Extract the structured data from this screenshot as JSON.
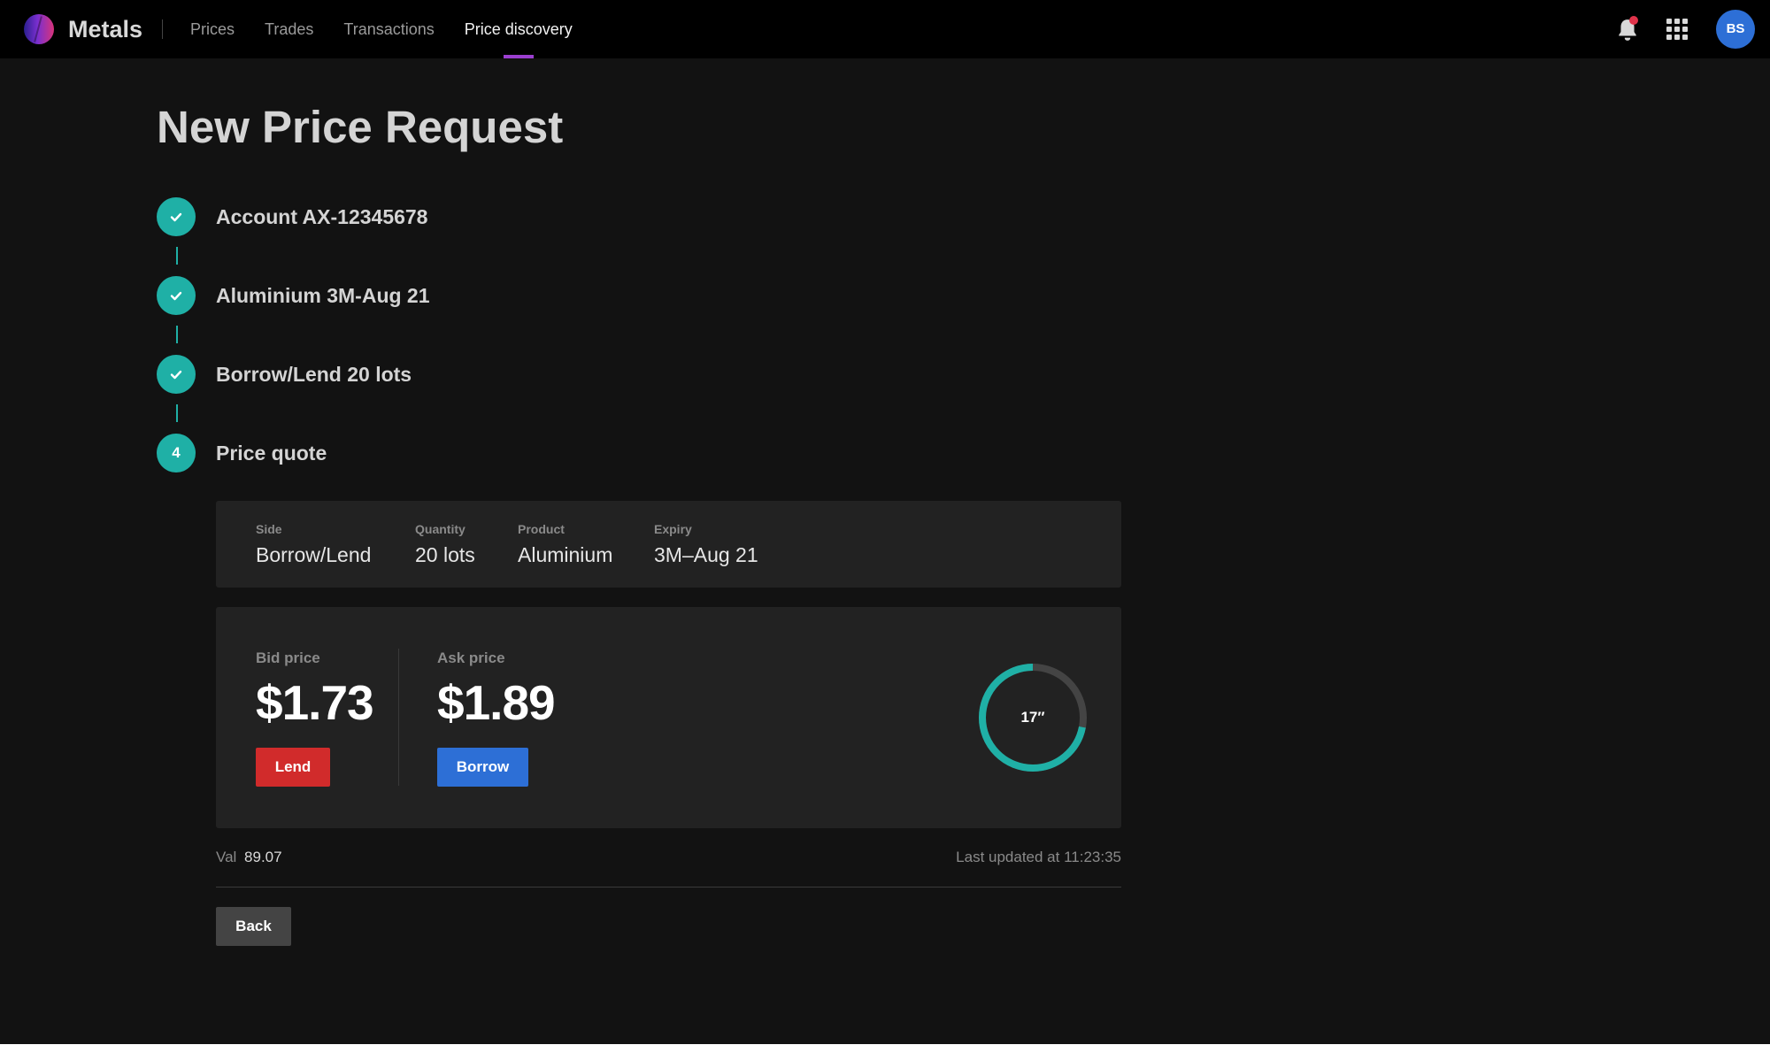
{
  "app": {
    "name": "Metals",
    "avatar_initials": "BS"
  },
  "nav": {
    "items": [
      {
        "label": "Prices",
        "active": false
      },
      {
        "label": "Trades",
        "active": false
      },
      {
        "label": "Transactions",
        "active": false
      },
      {
        "label": "Price discovery",
        "active": true
      }
    ]
  },
  "page": {
    "title": "New Price Request"
  },
  "steps": [
    {
      "label": "Account AX-12345678",
      "state": "done",
      "marker": ""
    },
    {
      "label": "Aluminium 3M-Aug 21",
      "state": "done",
      "marker": ""
    },
    {
      "label": "Borrow/Lend 20 lots",
      "state": "done",
      "marker": ""
    },
    {
      "label": "Price quote",
      "state": "current",
      "marker": "4"
    }
  ],
  "summary": {
    "side": {
      "label": "Side",
      "value": "Borrow/Lend"
    },
    "quantity": {
      "label": "Quantity",
      "value": "20 lots"
    },
    "product": {
      "label": "Product",
      "value": "Aluminium"
    },
    "expiry": {
      "label": "Expiry",
      "value": "3M–Aug 21"
    }
  },
  "quote": {
    "bid": {
      "label": "Bid price",
      "value": "$1.73",
      "action": "Lend"
    },
    "ask": {
      "label": "Ask price",
      "value": "$1.89",
      "action": "Borrow"
    },
    "timer": {
      "text": "17″",
      "progress": 0.72
    }
  },
  "footer": {
    "val_label": "Val",
    "val_value": "89.07",
    "last_updated": "Last updated at 11:23:35",
    "back_label": "Back"
  },
  "colors": {
    "accent_teal": "#1fb0a6",
    "lend_red": "#d12b2b",
    "borrow_blue": "#2d6fd6",
    "nav_indicator": "#9b3fd0"
  },
  "icons": {
    "notification": "bell-icon",
    "apps": "grid-icon",
    "step_done": "check-icon"
  }
}
